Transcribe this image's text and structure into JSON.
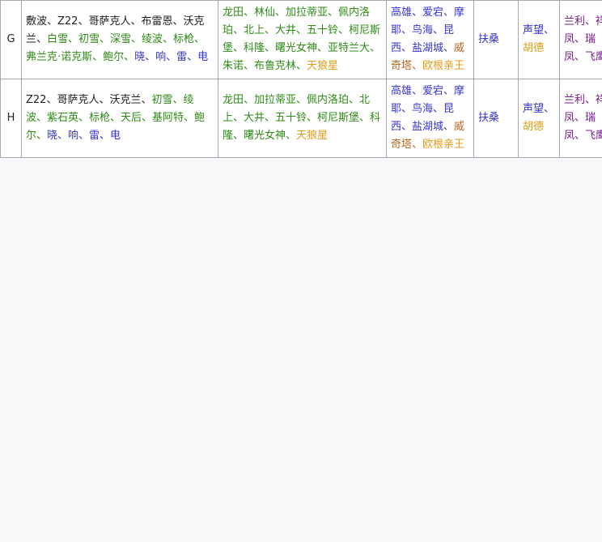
{
  "rows": [
    {
      "key": "G",
      "c1": [
        {
          "t": "敷波、Z22、哥萨克人、布雷恩、沃克兰、",
          "c": "s1"
        },
        {
          "t": "白雪、初雪、深雪、绫波、标枪、",
          "c": "s2"
        },
        {
          "t": "弗兰克·诺克斯、鲍尔、",
          "c": "s2"
        },
        {
          "t": "晓、响、雷、电",
          "c": "s3"
        }
      ],
      "c2": [
        {
          "t": "龙田、林仙、加拉蒂亚、佩内洛珀、北上、大井、五十铃、柯尼斯堡、科隆、曙光女神、亚特兰大、朱诺、布鲁克林、",
          "c": "s2"
        },
        {
          "t": "天狼星",
          "c": "s4"
        }
      ],
      "c3": [
        {
          "t": "高雄、爱宕、摩耶、鸟海、昆西、盐湖城、",
          "c": "s3"
        },
        {
          "t": "威奇塔、",
          "c": "s6"
        },
        {
          "t": "欧根亲王",
          "c": "s4"
        }
      ],
      "c4": [
        {
          "t": "扶桑",
          "c": "s3"
        }
      ],
      "c5": [
        {
          "t": "声望、",
          "c": "s3"
        },
        {
          "t": "胡德",
          "c": "s4"
        }
      ],
      "c6": [
        {
          "t": "兰利、祥凤、瑞凤、飞鹰",
          "c": "s5"
        }
      ]
    },
    {
      "key": "H",
      "c1": [
        {
          "t": "Z22、哥萨克人、沃克兰、",
          "c": "s1"
        },
        {
          "t": "初雪、绫波、紫石英、标枪、天后、基阿特、",
          "c": "s2"
        },
        {
          "t": "鲍尔、",
          "c": "s2"
        },
        {
          "t": "晓、响、雷、电",
          "c": "s3"
        }
      ],
      "c2": [
        {
          "t": "龙田、加拉蒂亚、佩内洛珀、北上、大井、五十铃、柯尼斯堡、科隆、曙光女神、",
          "c": "s2"
        },
        {
          "t": "天狼星",
          "c": "s4"
        }
      ],
      "c3": [
        {
          "t": "高雄、爱宕、摩耶、鸟海、昆西、盐湖城、",
          "c": "s3"
        },
        {
          "t": "威奇塔、",
          "c": "s6"
        },
        {
          "t": "欧根亲王",
          "c": "s4"
        }
      ],
      "c4": [
        {
          "t": "扶桑",
          "c": "s3"
        }
      ],
      "c5": [
        {
          "t": "声望、",
          "c": "s3"
        },
        {
          "t": "胡德",
          "c": "s4"
        }
      ],
      "c6": [
        {
          "t": "兰利、祥凤、瑞凤、飞鹰",
          "c": "s5"
        }
      ]
    }
  ]
}
